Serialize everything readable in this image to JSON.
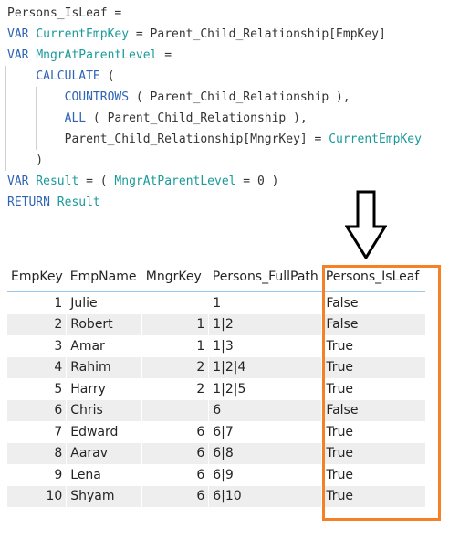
{
  "code": {
    "measure_name": "Persons_IsLeaf",
    "lines": [
      [
        {
          "t": "Persons_IsLeaf =",
          "c": "plain"
        }
      ],
      [
        {
          "t": "VAR ",
          "c": "kw"
        },
        {
          "t": "CurrentEmpKey",
          "c": "var"
        },
        {
          "t": " = Parent_Child_Relationship[EmpKey]",
          "c": "plain"
        }
      ],
      [
        {
          "t": "VAR ",
          "c": "kw"
        },
        {
          "t": "MngrAtParentLevel",
          "c": "var"
        },
        {
          "t": " =",
          "c": "plain"
        }
      ],
      [
        {
          "t": "    ",
          "c": "plain"
        },
        {
          "t": "CALCULATE",
          "c": "kw"
        },
        {
          "t": " (",
          "c": "plain"
        }
      ],
      [
        {
          "t": "        ",
          "c": "plain"
        },
        {
          "t": "COUNTROWS",
          "c": "kw"
        },
        {
          "t": " ( Parent_Child_Relationship ),",
          "c": "plain"
        }
      ],
      [
        {
          "t": "        ",
          "c": "plain"
        },
        {
          "t": "ALL",
          "c": "kw"
        },
        {
          "t": " ( Parent_Child_Relationship ),",
          "c": "plain"
        }
      ],
      [
        {
          "t": "        Parent_Child_Relationship[MngrKey] = ",
          "c": "plain"
        },
        {
          "t": "CurrentEmpKey",
          "c": "var"
        }
      ],
      [
        {
          "t": "    )",
          "c": "plain"
        }
      ],
      [
        {
          "t": "VAR ",
          "c": "kw"
        },
        {
          "t": "Result",
          "c": "var"
        },
        {
          "t": " = ( ",
          "c": "plain"
        },
        {
          "t": "MngrAtParentLevel",
          "c": "var"
        },
        {
          "t": " = 0 )",
          "c": "plain"
        }
      ],
      [
        {
          "t": "RETURN ",
          "c": "kw"
        },
        {
          "t": "Result",
          "c": "var"
        }
      ]
    ]
  },
  "annotation": {
    "arrow_icon": "down-arrow-outline",
    "highlight_color": "#f58025",
    "highlight_target_column": "Persons_IsLeaf"
  },
  "table": {
    "columns": [
      "EmpKey",
      "EmpName",
      "MngrKey",
      "Persons_FullPath",
      "Persons_IsLeaf"
    ],
    "rows": [
      [
        "1",
        "Julie",
        "",
        "1",
        "False"
      ],
      [
        "2",
        "Robert",
        "1",
        "1|2",
        "False"
      ],
      [
        "3",
        "Amar",
        "1",
        "1|3",
        "True"
      ],
      [
        "4",
        "Rahim",
        "2",
        "1|2|4",
        "True"
      ],
      [
        "5",
        "Harry",
        "2",
        "1|2|5",
        "True"
      ],
      [
        "6",
        "Chris",
        "",
        "6",
        "False"
      ],
      [
        "7",
        "Edward",
        "6",
        "6|7",
        "True"
      ],
      [
        "8",
        "Aarav",
        "6",
        "6|8",
        "True"
      ],
      [
        "9",
        "Lena",
        "6",
        "6|9",
        "True"
      ],
      [
        "10",
        "Shyam",
        "6",
        "6|10",
        "True"
      ]
    ]
  }
}
